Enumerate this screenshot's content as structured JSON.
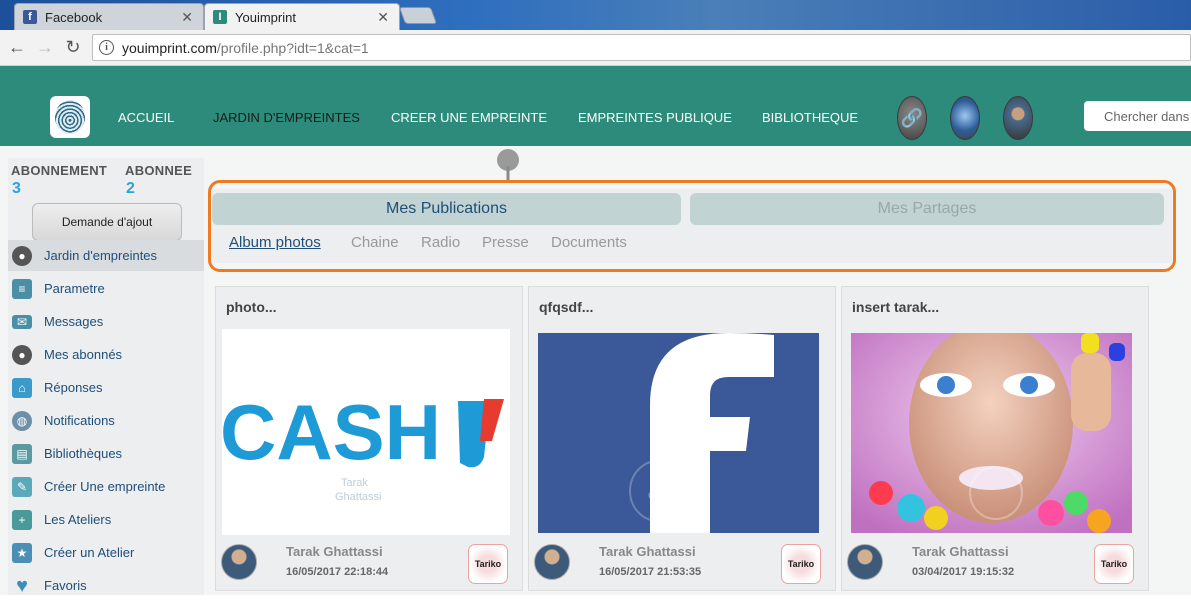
{
  "browser": {
    "tabs": [
      {
        "title": "Facebook",
        "icon": "facebook-icon",
        "color": "#3b5998"
      },
      {
        "title": "Youimprint",
        "icon": "youimprint-icon",
        "color": "#2c8b7a"
      }
    ],
    "url_host": "youimprint.com",
    "url_path": "/profile.php?idt=1&cat=1"
  },
  "header": {
    "menu": [
      "ACCUEIL",
      "JARDIN D'EMPREINTES",
      "CREER UNE EMPREINTE",
      "EMPREINTES PUBLIQUE",
      "BIBLIOTHEQUE"
    ],
    "search_placeholder": "Chercher dans",
    "brand_color": "#2c8b7a"
  },
  "sidebar": {
    "abonnement_label": "ABONNEMENT",
    "abonnement_count": "3",
    "abonnee_label": "ABONNEE",
    "abonnee_count": "2",
    "add_button": "Demande d'ajout",
    "items": [
      {
        "label": "Jardin d'empreintes",
        "icon": "user-icon"
      },
      {
        "label": "Parametre",
        "icon": "settings-icon"
      },
      {
        "label": "Messages",
        "icon": "envelope-icon"
      },
      {
        "label": "Mes abonnés",
        "icon": "users-icon"
      },
      {
        "label": "Réponses",
        "icon": "home-icon"
      },
      {
        "label": "Notifications",
        "icon": "globe-icon"
      },
      {
        "label": "Bibliothèques",
        "icon": "library-icon"
      },
      {
        "label": "Créer Une empreinte",
        "icon": "create-icon"
      },
      {
        "label": "Les Ateliers",
        "icon": "plus-icon"
      },
      {
        "label": "Créer un Atelier",
        "icon": "star-icon"
      },
      {
        "label": "Favoris",
        "icon": "heart-icon"
      }
    ]
  },
  "main": {
    "tabs": [
      "Mes Publications",
      "Mes Partages"
    ],
    "subtabs": [
      "Album photos",
      "Chaine",
      "Radio",
      "Presse",
      "Documents"
    ],
    "highlight_color": "#f07a22",
    "cards": [
      {
        "title": "photo...",
        "image": "cash-logo",
        "author": "Tarak Ghattassi",
        "date": "16/05/2017 22:18:44",
        "stamp": "Tariko",
        "image_text": "CASH"
      },
      {
        "title": "qfqsdf...",
        "image": "facebook-logo",
        "author": "Tarak Ghattassi",
        "date": "16/05/2017 21:53:35",
        "stamp": "Tariko",
        "image_text": "f"
      },
      {
        "title": "insert tarak...",
        "image": "woman-portrait",
        "author": "Tarak Ghattassi",
        "date": "03/04/2017 19:15:32",
        "stamp": "Tariko"
      }
    ]
  }
}
